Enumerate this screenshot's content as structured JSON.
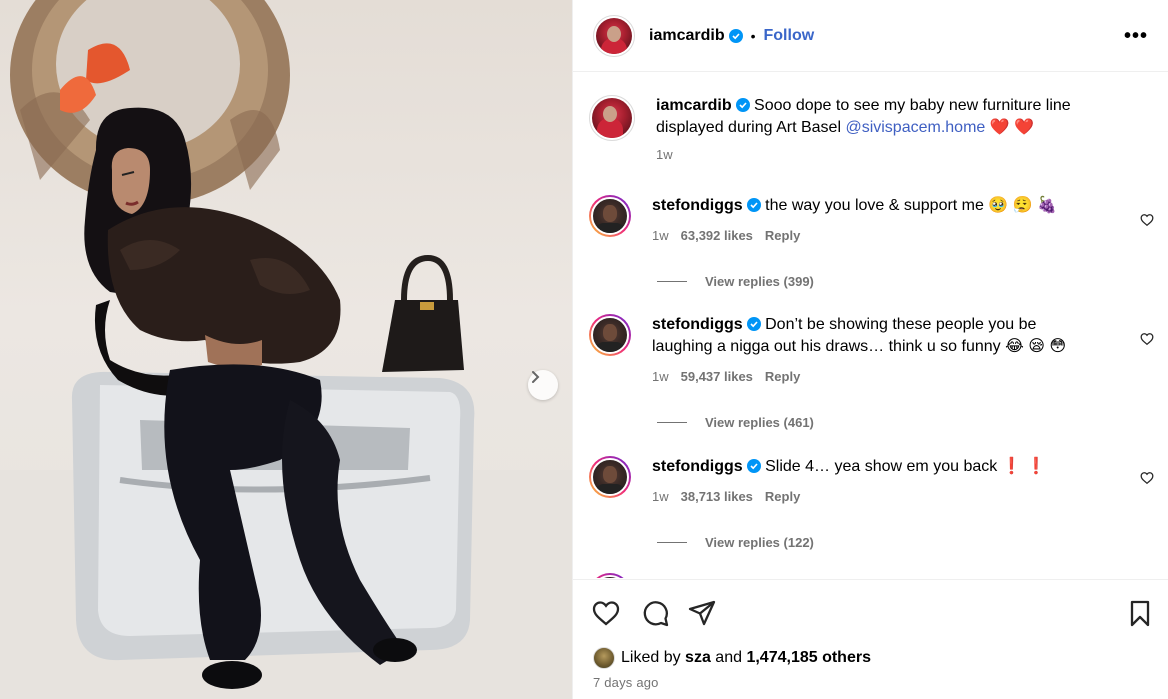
{
  "post": {
    "author": "iamcardib",
    "follow_label": "Follow",
    "separator": "•",
    "more_label": "•••"
  },
  "caption": {
    "username": "iamcardib",
    "text": "Sooo dope to see my baby new furniture line displayed during Art Basel",
    "mention": "@sivispacem.home",
    "emoji": "❤️ ❤️",
    "time": "1w"
  },
  "comments": [
    {
      "username": "stefondiggs",
      "text": "the way you love & support me",
      "emoji": "🥹 😮‍💨 🍇",
      "time": "1w",
      "likes": "63,392 likes",
      "reply_label": "Reply",
      "view_replies": "View replies (399)"
    },
    {
      "username": "stefondiggs",
      "text": "Don’t be showing these people you be laughing a nigga out his draws… think u so funny",
      "emoji": "😂 😪 😳",
      "time": "1w",
      "likes": "59,437 likes",
      "reply_label": "Reply",
      "view_replies": "View replies (461)"
    },
    {
      "username": "stefondiggs",
      "text": "Slide 4… yea show em you back",
      "emoji": "❗ ❗",
      "time": "1w",
      "likes": "38,713 likes",
      "reply_label": "Reply",
      "view_replies": "View replies (122)"
    }
  ],
  "footer": {
    "liked_by_prefix": "Liked by",
    "liked_by_user": "sza",
    "liked_by_and": "and",
    "liked_by_count": "1,474,185 others",
    "posted": "7 days ago"
  },
  "icons": {
    "like": "heart-icon",
    "comment": "comment-icon",
    "share": "share-icon",
    "save": "bookmark-icon",
    "next": "chevron-right-icon",
    "verified": "verified-badge-icon"
  },
  "colors": {
    "link": "#3f5fc2",
    "follow": "#3a66c9",
    "muted": "#737373",
    "verified": "#0095f6"
  }
}
